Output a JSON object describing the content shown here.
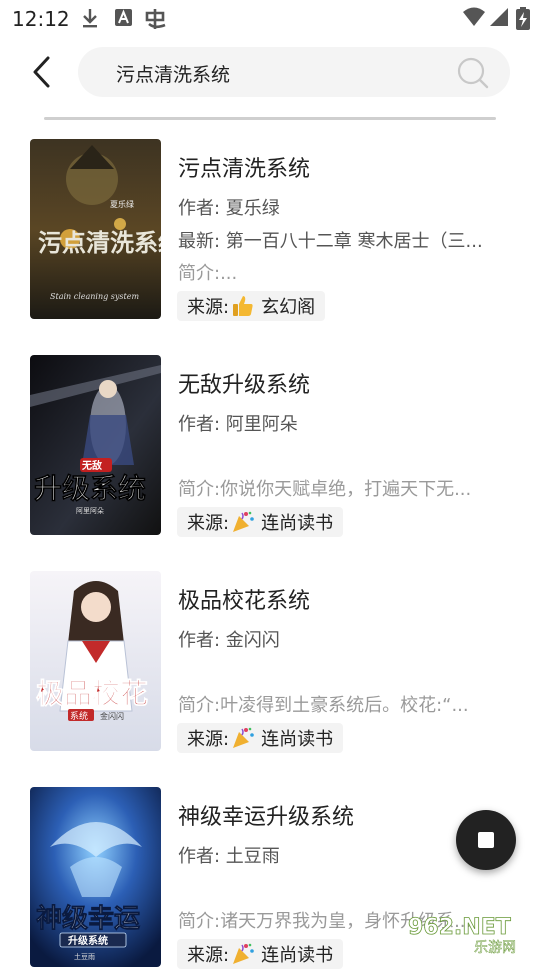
{
  "status_bar": {
    "time": "12:12",
    "left_icons": [
      "download-icon",
      "a-badge-icon",
      "app-glyph-icon"
    ],
    "right_icons": [
      "wifi-icon",
      "signal-icon",
      "battery-charging-icon"
    ]
  },
  "header": {
    "search_query": "污点清洗系统"
  },
  "books": [
    {
      "title": "污点清洗系统",
      "author": "作者: 夏乐绿",
      "latest": "最新: 第一百八十二章 寒木居士（三...",
      "intro": "简介:...",
      "source_label": "来源:",
      "source_name": "玄幻阁",
      "source_icon": "thumbs-up-icon",
      "cover_text": "污点清洗系统",
      "cover_author": "夏乐绿",
      "cover_subtitle": "Stain cleaning system",
      "cover_colors": [
        "#2a2418",
        "#4a3a1e",
        "#1c1a14"
      ]
    },
    {
      "title": "无敌升级系统",
      "author": "作者: 阿里阿朵",
      "latest": "",
      "intro": "简介:你说你天赋卓绝，打遍天下无...",
      "source_label": "来源:",
      "source_name": "连尚读书",
      "source_icon": "party-popper-icon",
      "cover_text": "升级系统",
      "cover_badge": "无敌",
      "cover_author": "阿里阿朵",
      "cover_colors": [
        "#0c0c10",
        "#2b2f3a",
        "#3a3f4e"
      ]
    },
    {
      "title": "极品校花系统",
      "author": "作者: 金闪闪",
      "latest": "",
      "intro": "简介:叶凌得到土豪系统后。校花:“...",
      "source_label": "来源:",
      "source_name": "连尚读书",
      "source_icon": "party-popper-icon",
      "cover_text": "极品校花",
      "cover_badge": "系统",
      "cover_author": "金闪闪",
      "cover_colors": [
        "#f6f4f8",
        "#d7dbe8",
        "#c22a2a"
      ]
    },
    {
      "title": "神级幸运升级系统",
      "author": "作者: 土豆雨",
      "latest": "",
      "intro": "简介:诸天万界我为皇，身怀升级系...",
      "source_label": "来源:",
      "source_name": "连尚读书",
      "source_icon": "party-popper-icon",
      "cover_text": "神级幸运",
      "cover_badge": "升级系统",
      "cover_author": "土豆雨",
      "cover_colors": [
        "#0a1a40",
        "#2c5fb5",
        "#8fd0ff"
      ]
    }
  ],
  "watermark": {
    "brand": "962.NET",
    "sub": "乐游网"
  },
  "colors": {
    "background": "#ffffff",
    "search_bg": "#f4f4f4",
    "source_bg": "#f3f3f3",
    "fab": "#222222",
    "intro_text": "#9a9a9a"
  }
}
